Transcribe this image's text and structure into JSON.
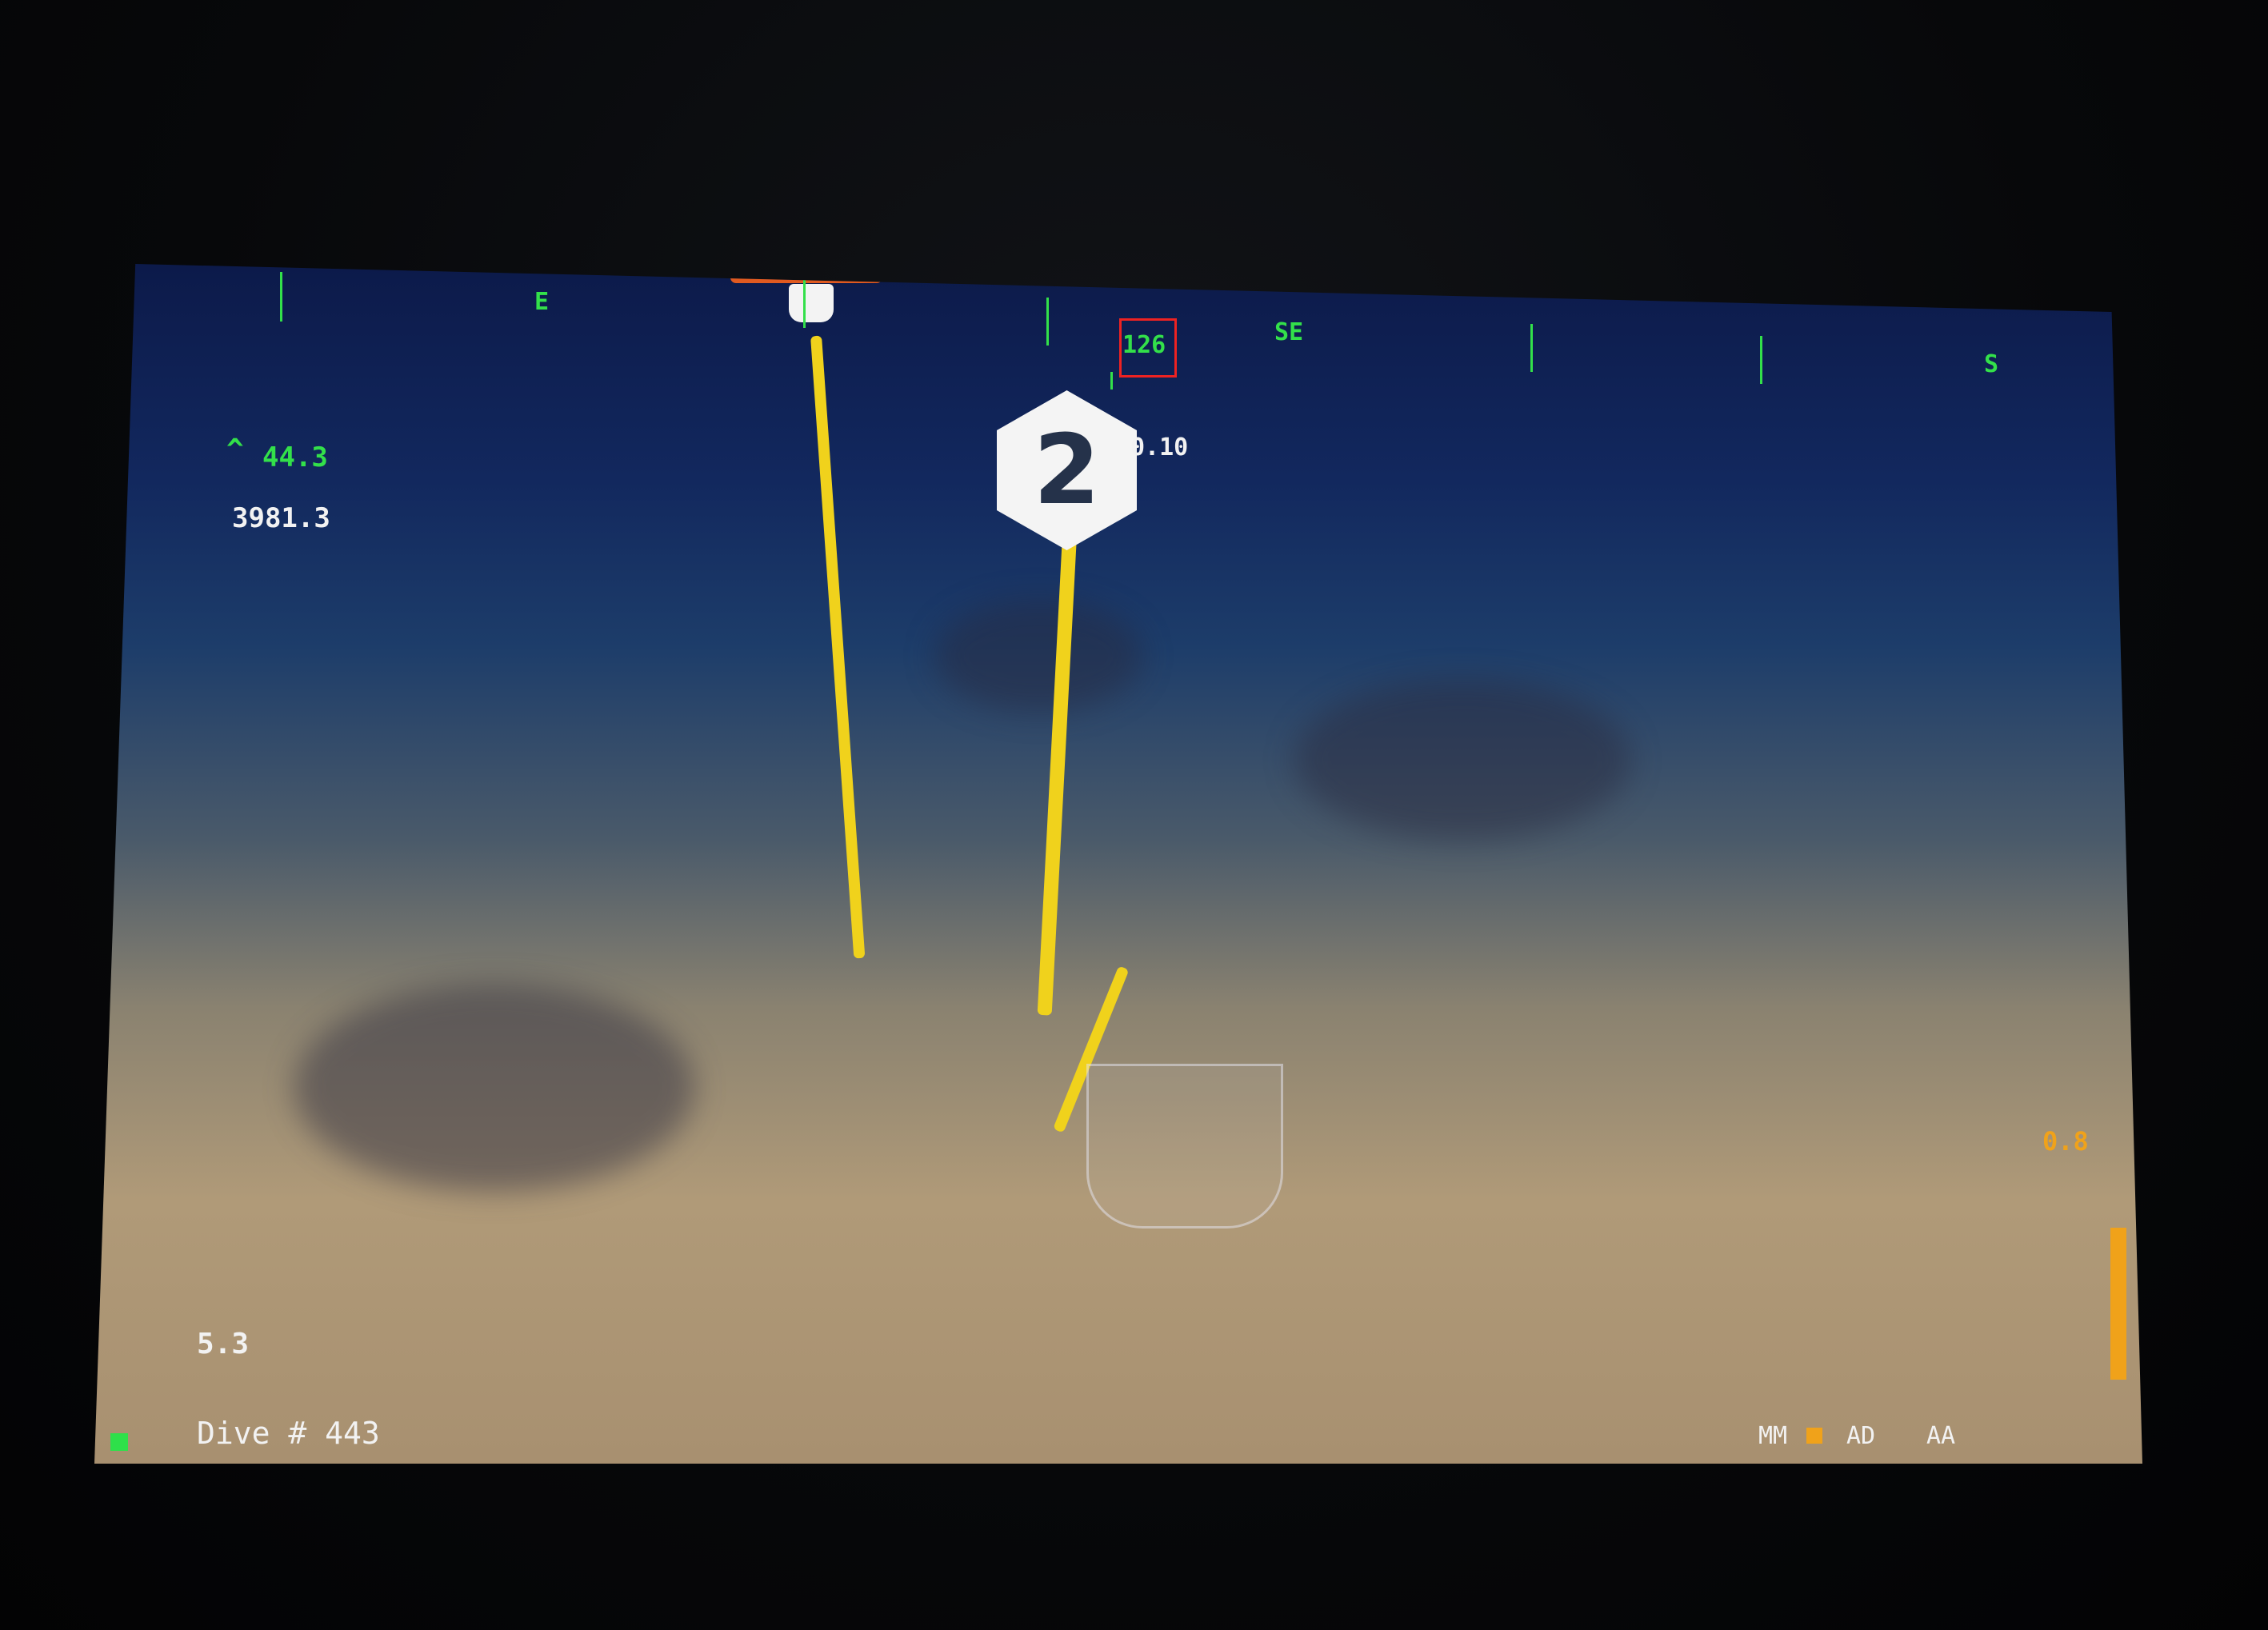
{
  "hud": {
    "compass": {
      "e": "E",
      "se": "SE",
      "s": "S",
      "heading": "126"
    },
    "altitude": "44.3",
    "depth": "3981.3",
    "marker_readout": "0.10",
    "marker_number": "2",
    "range_value": "0.8",
    "left_value": "5.3",
    "dive_label": "Dive # 443",
    "modes": {
      "mm": "MM",
      "ad": "AD",
      "aa": "AA"
    }
  },
  "colors": {
    "hud_green": "#33e04a",
    "heading_box": "#ee2222",
    "accent_orange": "#f0a21a",
    "rope_yellow": "#f0d21c"
  },
  "icons": {
    "altitude": "up-caret-icon",
    "status": "green-square-icon"
  }
}
